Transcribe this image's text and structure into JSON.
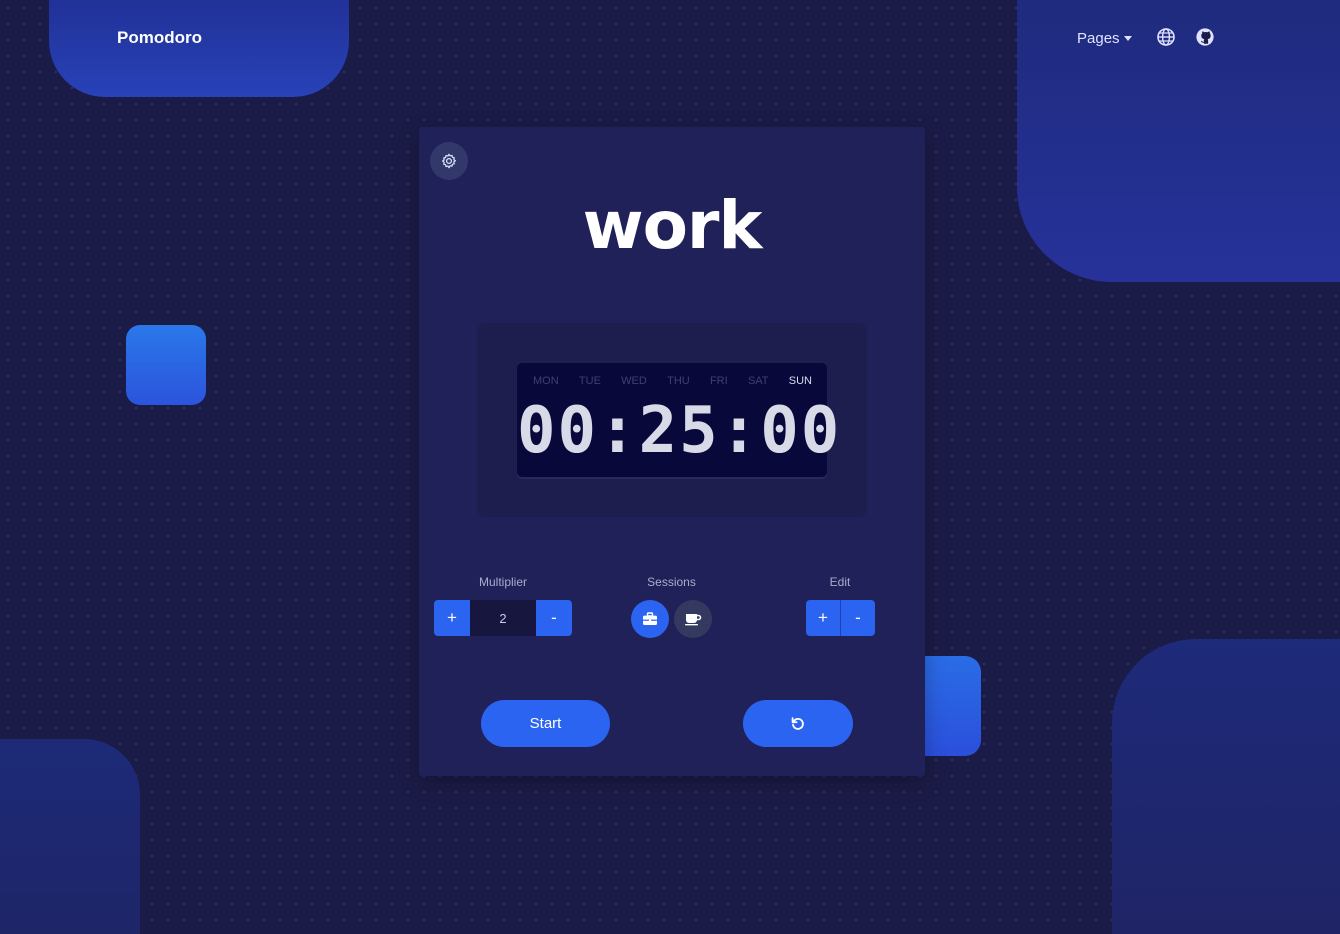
{
  "app": {
    "brand": "Pomodoro"
  },
  "nav": {
    "pages_label": "Pages",
    "icons": [
      "globe-icon",
      "github-icon"
    ]
  },
  "timer": {
    "mode": "work",
    "days": [
      "MON",
      "TUE",
      "WED",
      "THU",
      "FRI",
      "SAT",
      "SUN"
    ],
    "active_day": "SUN",
    "display": "00:25:00"
  },
  "controls": {
    "multiplier": {
      "label": "Multiplier",
      "plus": "+",
      "minus": "-",
      "value": "2"
    },
    "sessions": {
      "label": "Sessions",
      "items": [
        "briefcase-icon",
        "coffee-icon"
      ],
      "active": "work"
    },
    "edit": {
      "label": "Edit",
      "plus": "+",
      "minus": "-"
    }
  },
  "actions": {
    "start_label": "Start",
    "reset_icon": "undo-icon"
  },
  "colors": {
    "background": "#1b1b47",
    "card": "#21215a",
    "accent": "#2c64f2",
    "clock_face": "#08083a",
    "digit": "#d9dae8"
  }
}
